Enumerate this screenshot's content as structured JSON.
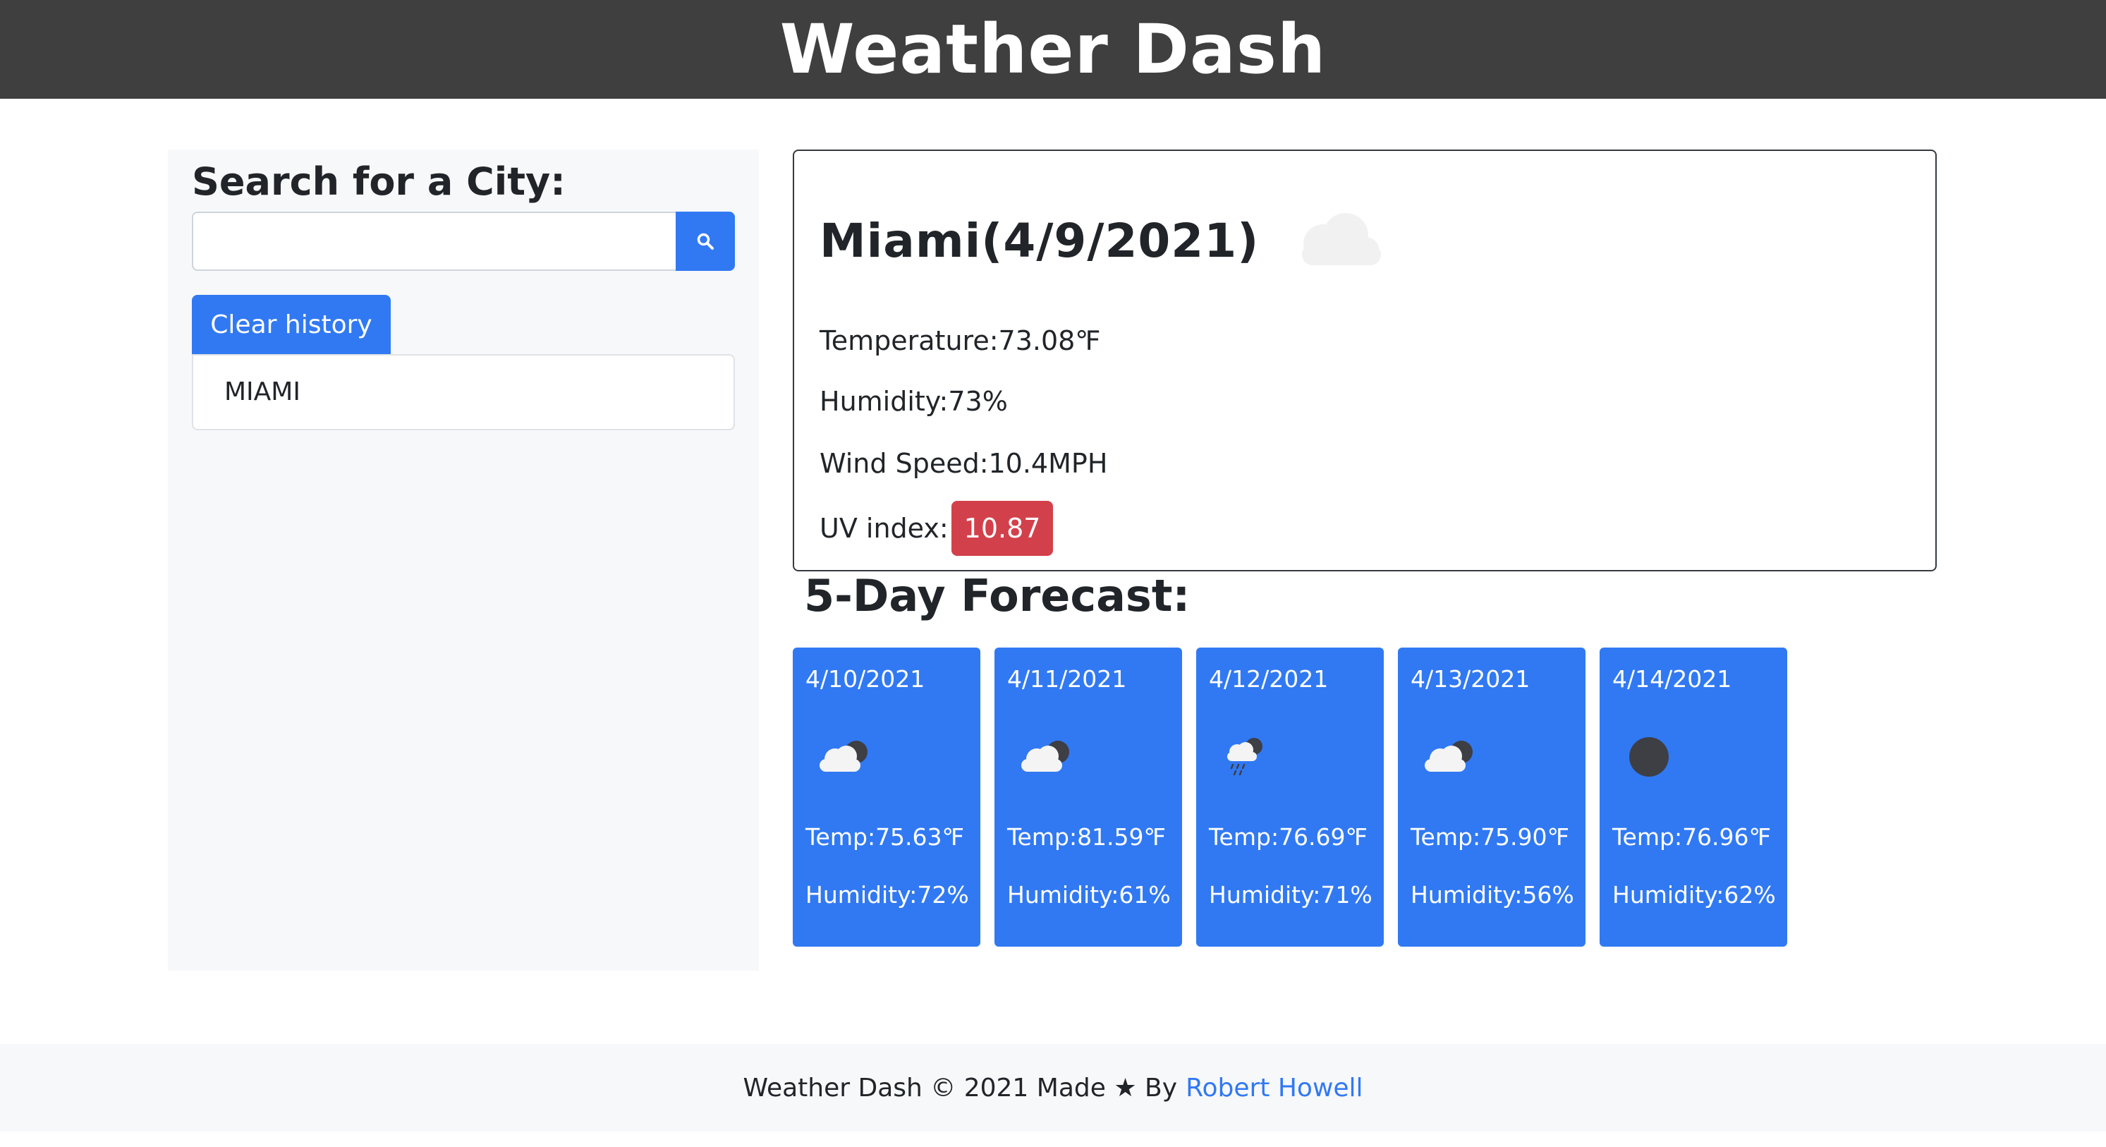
{
  "header": {
    "title": "Weather Dash"
  },
  "sidebar": {
    "heading": "Search for a City:",
    "search_placeholder": "",
    "search_icon": "search-icon",
    "clear_label": "Clear history",
    "history": [
      "MIAMI"
    ]
  },
  "current": {
    "city_heading": "Miami(4/9/2021)",
    "icon": "cloud-icon",
    "temperature": "Temperature:73.08℉",
    "humidity": "Humidity:73%",
    "wind": "Wind Speed:10.4MPH",
    "uv_label": "UV index:",
    "uv_value": "10.87",
    "uv_color": "#d2414b"
  },
  "forecast": {
    "heading": "5-Day Forecast:",
    "days": [
      {
        "date": "4/10/2021",
        "icon": "partly-cloudy-night-icon",
        "temp": "Temp:75.63℉",
        "humidity": "Humidity:72%"
      },
      {
        "date": "4/11/2021",
        "icon": "partly-cloudy-night-icon",
        "temp": "Temp:81.59℉",
        "humidity": "Humidity:61%"
      },
      {
        "date": "4/12/2021",
        "icon": "rain-night-icon",
        "temp": "Temp:76.69℉",
        "humidity": "Humidity:71%"
      },
      {
        "date": "4/13/2021",
        "icon": "partly-cloudy-night-icon",
        "temp": "Temp:75.90℉",
        "humidity": "Humidity:56%"
      },
      {
        "date": "4/14/2021",
        "icon": "clear-night-icon",
        "temp": "Temp:76.96℉",
        "humidity": "Humidity:62%"
      }
    ]
  },
  "footer": {
    "text": "Weather Dash © 2021 Made ★ By",
    "author": "Robert Howell"
  },
  "colors": {
    "accent": "#3179f3",
    "header_bg": "#3f3f3f",
    "uv_high": "#d2414b"
  }
}
